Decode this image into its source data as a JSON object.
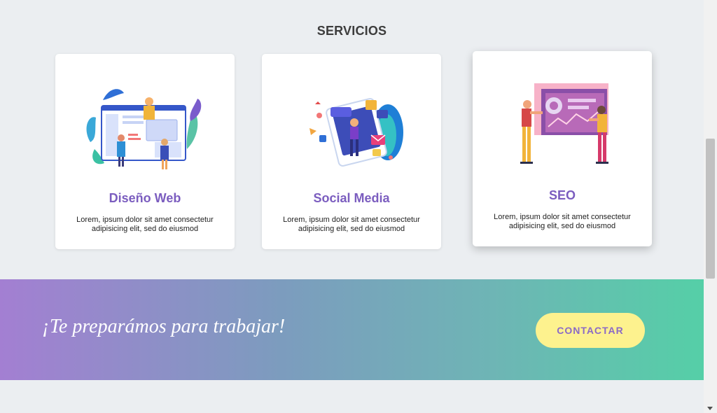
{
  "section": {
    "title": "SERVICIOS"
  },
  "cards": [
    {
      "title": "Diseño Web",
      "desc_line1": "Lorem, ipsum dolor sit amet consectetur",
      "desc_line2": "adipisicing elit, sed do eiusmod",
      "illustration": "web-design-illustration"
    },
    {
      "title": "Social Media",
      "desc_line1": "Lorem, ipsum dolor sit amet consectetur",
      "desc_line2": "adipisicing elit, sed do eiusmod",
      "illustration": "social-media-illustration"
    },
    {
      "title": "SEO",
      "desc_line1": "Lorem, ipsum dolor sit amet consectetur",
      "desc_line2": "adipisicing elit, sed do eiusmod",
      "illustration": "seo-illustration"
    }
  ],
  "banner": {
    "text": "¡Te preparámos para trabajar!",
    "button_label": "CONTACTAR"
  },
  "colors": {
    "accent_purple": "#7b5dbf",
    "button_yellow": "#fdf28e",
    "gradient_start": "#a37fd2",
    "gradient_end": "#55cfa7",
    "background": "#ebeef1"
  }
}
